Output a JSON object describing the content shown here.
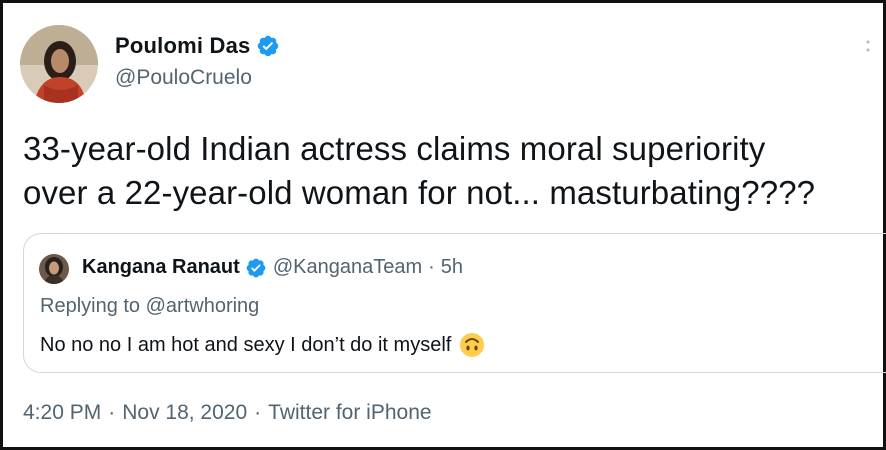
{
  "tweet": {
    "author_name": "Poulomi Das",
    "author_handle": "@PouloCruelo",
    "text_line1": "33-year-old Indian actress claims moral superiority",
    "text_line2": "over a 22-year-old woman for not... masturbating????",
    "time": "4:20 PM",
    "date": "Nov 18, 2020",
    "source": "Twitter for iPhone",
    "separator": "·"
  },
  "quote": {
    "author_name": "Kangana Ranaut",
    "author_handle": "@KanganaTeam",
    "separator": "·",
    "age": "5h",
    "replying_prefix": "Replying to",
    "replying_to": "@artwhoring",
    "text": "No no no I am hot and sexy I don’t do it myself"
  },
  "icons": {
    "verified": "verified-badge-icon",
    "caret": "chevron-down-icon",
    "emoji": "upside-down-face-emoji-icon"
  },
  "colors": {
    "verified_blue": "#1d9bf0",
    "secondary_text": "#536471",
    "border": "#cfd9de"
  }
}
